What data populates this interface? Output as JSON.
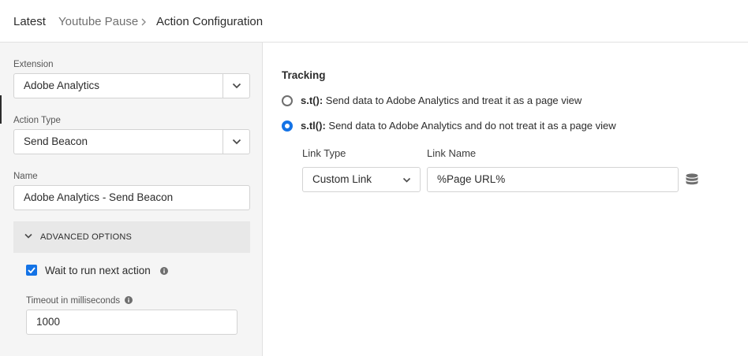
{
  "breadcrumb": {
    "root": "Latest",
    "rule": "Youtube Pause",
    "current": "Action Configuration"
  },
  "sidebar": {
    "extension": {
      "label": "Extension",
      "value": "Adobe Analytics"
    },
    "action_type": {
      "label": "Action Type",
      "value": "Send Beacon"
    },
    "name": {
      "label": "Name",
      "value": "Adobe Analytics - Send Beacon"
    },
    "advanced": {
      "label": "ADVANCED OPTIONS",
      "wait_label": "Wait to run next action",
      "wait_checked": true,
      "timeout_label": "Timeout in milliseconds",
      "timeout_value": "1000"
    }
  },
  "main": {
    "tracking_title": "Tracking",
    "options": [
      {
        "code": "s.t():",
        "text": " Send data to Adobe Analytics and treat it as a page view",
        "selected": false
      },
      {
        "code": "s.tl():",
        "text": " Send data to Adobe Analytics and do not treat it as a page view",
        "selected": true
      }
    ],
    "link_type": {
      "label": "Link Type",
      "value": "Custom Link"
    },
    "link_name": {
      "label": "Link Name",
      "value": "%Page URL%"
    }
  },
  "colors": {
    "accent": "#1473e6",
    "sidebar_bg": "#f5f5f5",
    "panel_bg": "#e8e8e8"
  },
  "icons": [
    "chevron-right-icon",
    "chevron-down-icon",
    "info-icon",
    "checkmark-icon",
    "data-element-icon"
  ]
}
